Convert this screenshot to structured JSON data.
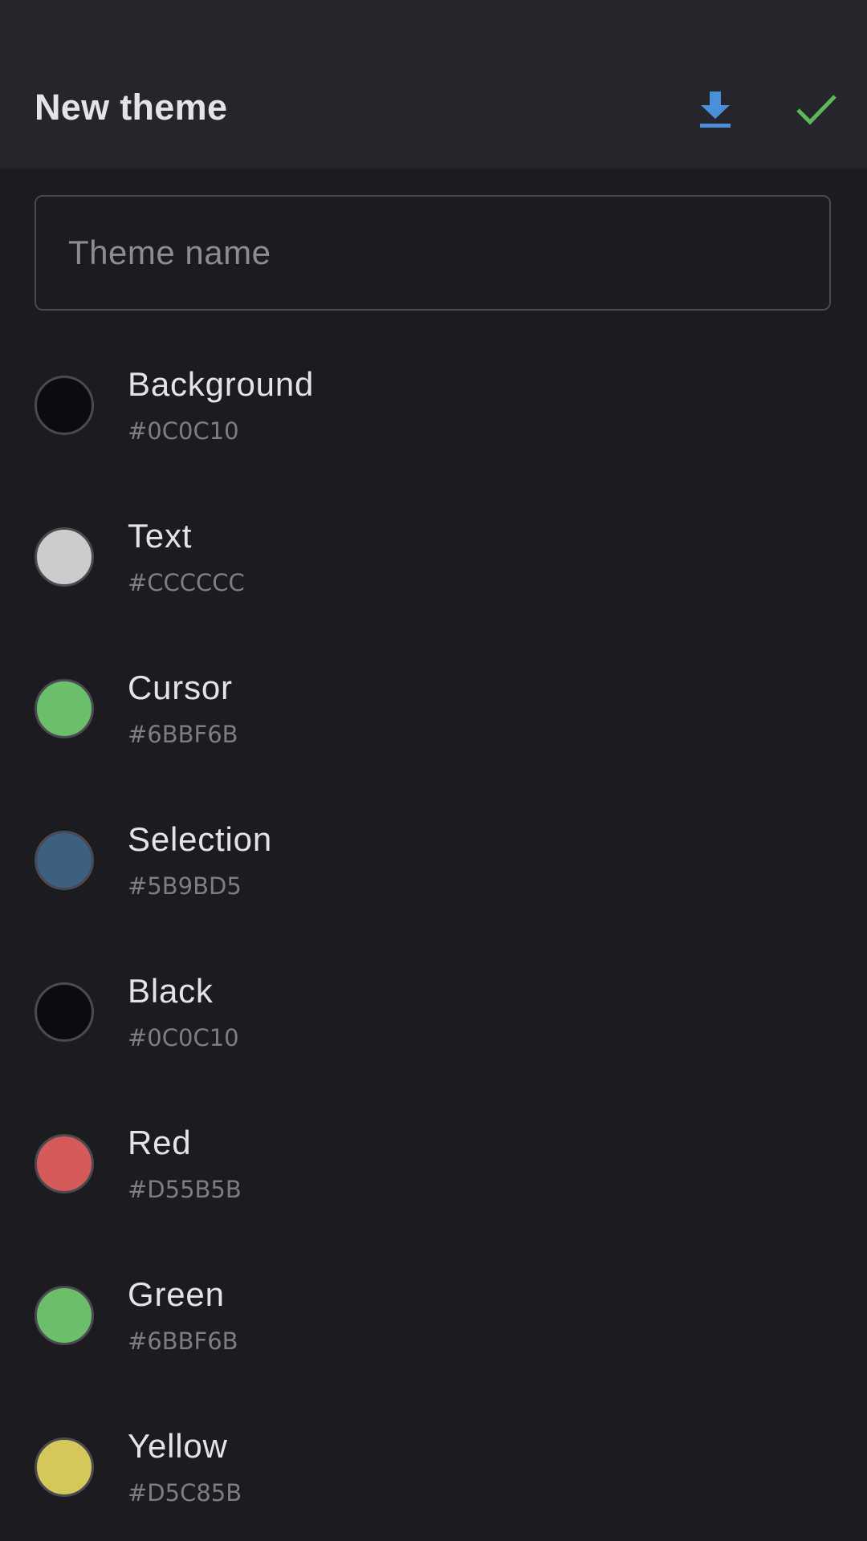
{
  "header": {
    "title": "New theme",
    "download_icon_color": "#4a90d9",
    "confirm_icon_color": "#5cb85c"
  },
  "theme_name_field": {
    "placeholder": "Theme name",
    "value": ""
  },
  "colors": [
    {
      "label": "Background",
      "hex": "#0C0C10",
      "swatch": "#0c0c10"
    },
    {
      "label": "Text",
      "hex": "#CCCCCC",
      "swatch": "#cccccc"
    },
    {
      "label": "Cursor",
      "hex": "#6BBF6B",
      "swatch": "#6bbf6b"
    },
    {
      "label": "Selection",
      "hex": "#5B9BD5",
      "swatch": "#3d5f80"
    },
    {
      "label": "Black",
      "hex": "#0C0C10",
      "swatch": "#0c0c10"
    },
    {
      "label": "Red",
      "hex": "#D55B5B",
      "swatch": "#d55b5b"
    },
    {
      "label": "Green",
      "hex": "#6BBF6B",
      "swatch": "#6bbf6b"
    },
    {
      "label": "Yellow",
      "hex": "#D5C85B",
      "swatch": "#d5c85b"
    }
  ]
}
